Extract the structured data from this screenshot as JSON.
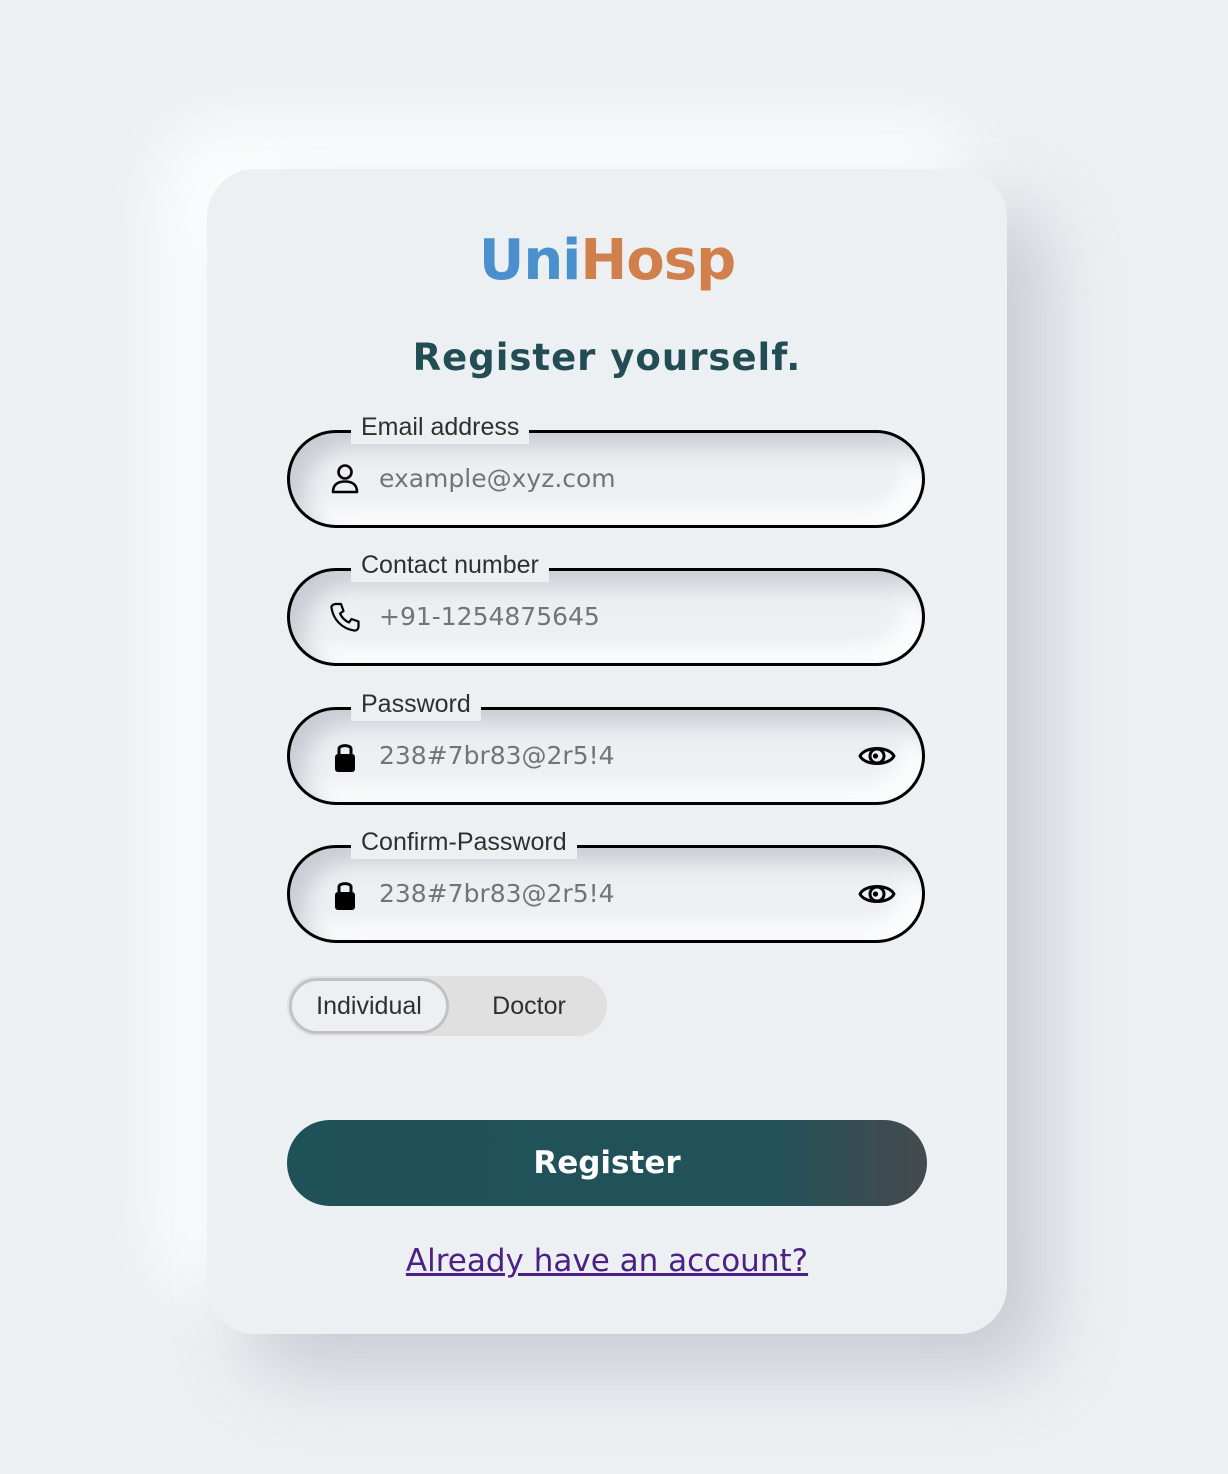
{
  "brand": {
    "part1": "Uni",
    "part2": "Hosp",
    "colors": {
      "uni": "#4a90cd",
      "hosp": "#d17f4b"
    }
  },
  "heading": "Register yourself.",
  "fields": {
    "email": {
      "label": "Email address",
      "value": "example@xyz.com",
      "icon": "user-icon"
    },
    "contact": {
      "label": "Contact number",
      "value": "+91-1254875645",
      "icon": "phone-icon"
    },
    "password": {
      "label": "Password",
      "value": "238#7br83@2r5!4",
      "icon": "lock-icon",
      "toggle_icon": "eye-icon"
    },
    "confirm_password": {
      "label": "Confirm-Password",
      "value": "238#7br83@2r5!4",
      "icon": "lock-icon",
      "toggle_icon": "eye-icon"
    }
  },
  "role_toggle": {
    "options": [
      "Individual",
      "Doctor"
    ],
    "selected": "Individual"
  },
  "register_button": "Register",
  "login_link": "Already have an account?",
  "colors": {
    "accent": "#224d55",
    "link": "#4d2088",
    "background": "#edf0f3"
  }
}
